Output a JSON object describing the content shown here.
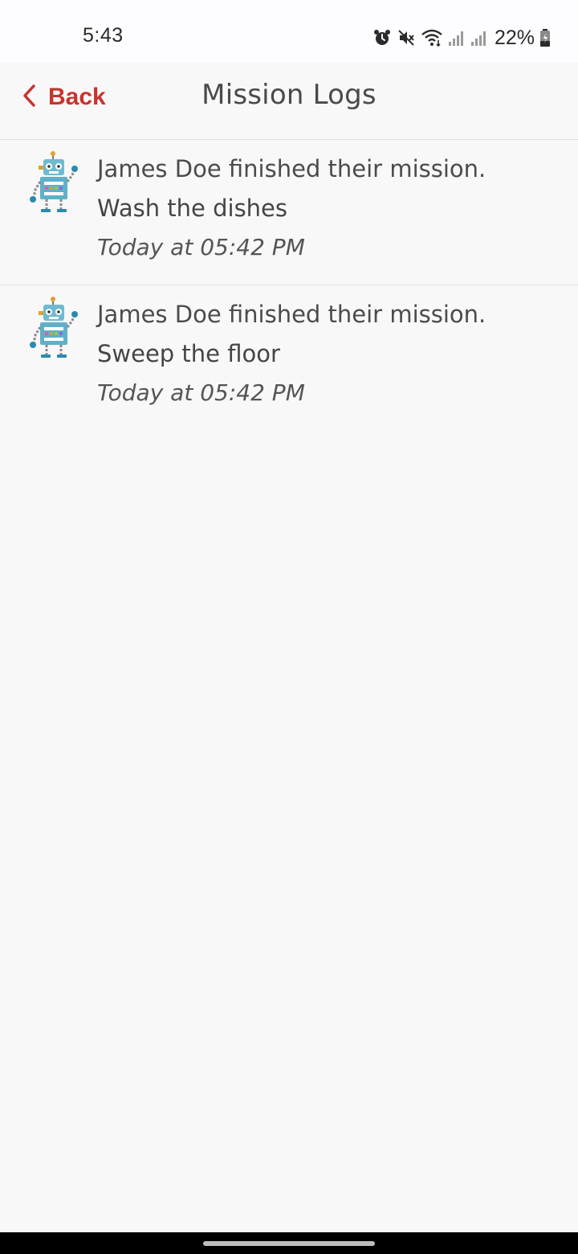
{
  "status_bar": {
    "time": "5:43",
    "battery": "22%",
    "icons": [
      "alarm-icon",
      "mute-icon",
      "wifi-icon",
      "signal-icon",
      "signal-icon",
      "battery-icon"
    ]
  },
  "header": {
    "back_label": "Back",
    "title": "Mission Logs"
  },
  "logs": [
    {
      "avatar": "robot-icon",
      "message": "James Doe finished their mission.",
      "mission": "Wash the dishes",
      "time": "Today at 05:42 PM"
    },
    {
      "avatar": "robot-icon",
      "message": "James Doe finished their mission.",
      "mission": "Sweep the floor",
      "time": "Today at 05:42 PM"
    }
  ],
  "colors": {
    "accent": "#c8332e",
    "background": "#f8f8f8",
    "divider": "#e2e2e2",
    "text": "#4b4b4b"
  }
}
